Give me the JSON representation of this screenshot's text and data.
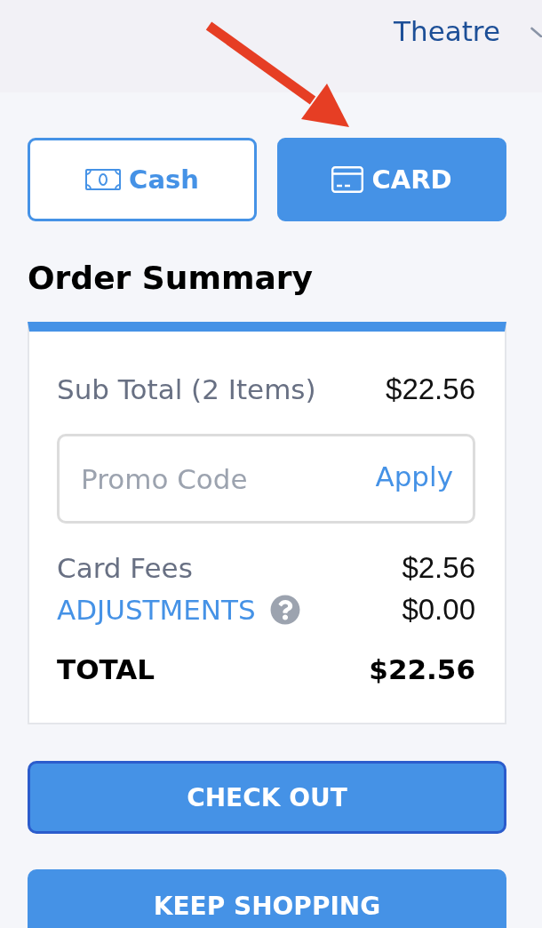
{
  "header": {
    "venue": "Theatre"
  },
  "payment_methods": [
    {
      "kind": "cash",
      "label": "Cash",
      "selected": false
    },
    {
      "kind": "card",
      "label": "CARD",
      "selected": true
    }
  ],
  "order_summary": {
    "title": "Order Summary",
    "subtotal": {
      "label": "Sub Total (2 Items)",
      "amount": "$22.56"
    },
    "promo": {
      "placeholder": "Promo Code",
      "action": "Apply"
    },
    "fees": [
      {
        "kind": "plain",
        "label": "Card Fees",
        "amount": "$2.56"
      },
      {
        "kind": "link",
        "label": "ADJUSTMENTS",
        "amount": "$0.00"
      }
    ],
    "total": {
      "label": "TOTAL",
      "amount": "$22.56"
    }
  },
  "actions": [
    {
      "label": "CHECK OUT",
      "focused": true
    },
    {
      "label": "KEEP SHOPPING",
      "focused": false
    }
  ]
}
